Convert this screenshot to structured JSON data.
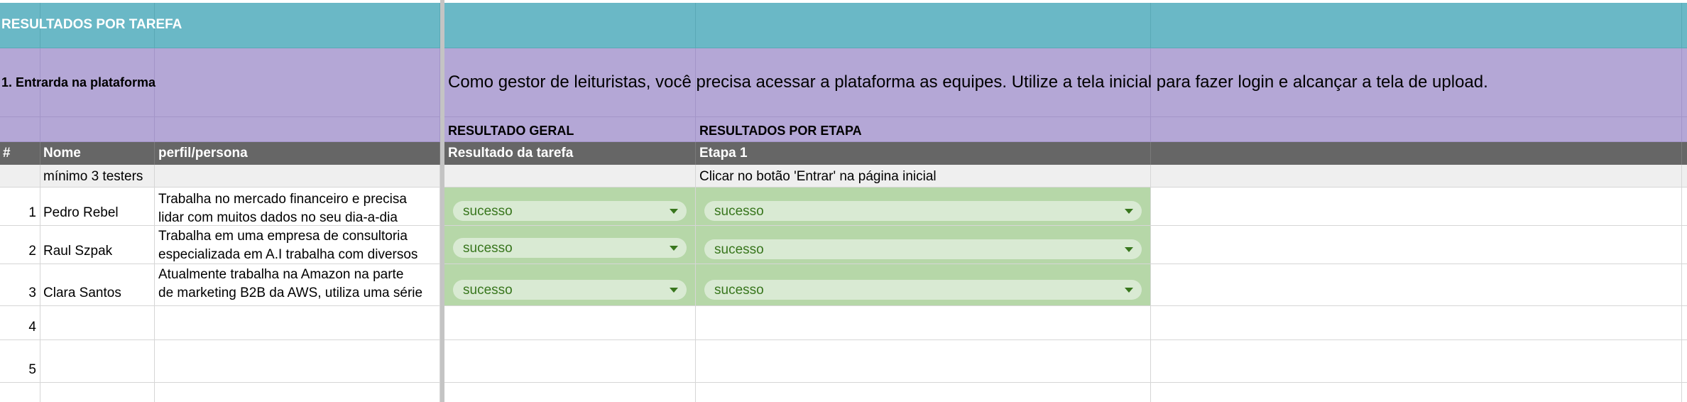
{
  "sheet": {
    "section_title": "RESULTADOS POR TAREFA",
    "task": {
      "title": "1. Entrarda na plataforma",
      "description": "Como gestor de leituristas, você precisa acessar a plataforma as equipes. Utilize a tela inicial para fazer login e alcançar a tela de upload."
    },
    "groups": {
      "general": "RESULTADO GERAL",
      "by_stage": "RESULTADOS POR ETAPA"
    },
    "columns": {
      "number": "#",
      "name": "Nome",
      "persona": "perfil/persona",
      "task_result": "Resultado da tarefa",
      "stage1": "Etapa 1"
    },
    "hints": {
      "testers": "mínimo 3 testers",
      "stage1_instruction": "Clicar no botão 'Entrar' na página inicial"
    },
    "rows": [
      {
        "number": "1",
        "name": "Pedro Rebel",
        "persona_line1": "Trabalha no mercado financeiro e precisa",
        "persona_line2": "lidar com muitos dados no seu dia-a-dia",
        "task_result": "sucesso",
        "stage1": "sucesso"
      },
      {
        "number": "2",
        "name": "Raul Szpak",
        "persona_line1": "Trabalha em uma empresa de consultoria",
        "persona_line2": "especializada em A.I trabalha com diversos",
        "task_result": "sucesso",
        "stage1": "sucesso"
      },
      {
        "number": "3",
        "name": "Clara Santos",
        "persona_line1": "Atualmente trabalha na Amazon na parte",
        "persona_line2": "de marketing B2B da AWS, utiliza uma série",
        "task_result": "sucesso",
        "stage1": "sucesso"
      },
      {
        "number": "4"
      },
      {
        "number": "5"
      }
    ]
  },
  "colors": {
    "teal_header": "#6ab8c6",
    "purple_band": "#b4a7d6",
    "dark_header": "#666666",
    "success_cell": "#b6d7a8",
    "success_chip": "#d9ead3",
    "success_text": "#38761d"
  },
  "icons": {
    "dropdown": "caret-down-icon"
  }
}
